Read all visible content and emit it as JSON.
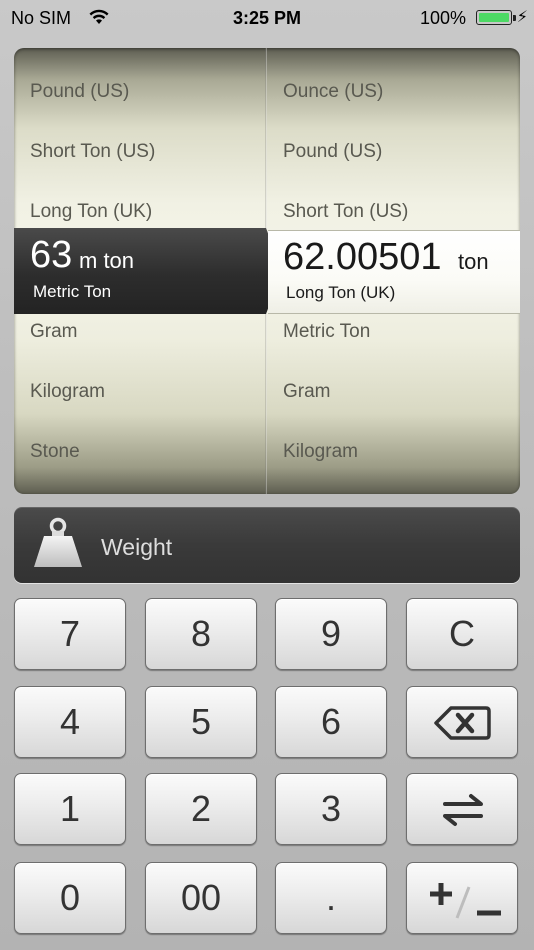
{
  "status_bar": {
    "carrier": "No SIM",
    "time": "3:25 PM",
    "battery": "100%"
  },
  "converter": {
    "from_list": [
      "Pound (US)",
      "Short Ton (US)",
      "Long Ton (UK)",
      "Gram",
      "Kilogram",
      "Stone"
    ],
    "to_list": [
      "Ounce (US)",
      "Pound (US)",
      "Short Ton (US)",
      "Metric Ton",
      "Gram",
      "Kilogram"
    ],
    "from_selected": {
      "value": "63",
      "unit": "m ton",
      "name": "Metric Ton"
    },
    "to_selected": {
      "value": "62.00501",
      "unit": "ton",
      "name": "Long Ton (UK)"
    }
  },
  "category": {
    "label": "Weight",
    "icon": "weight-icon"
  },
  "keypad": {
    "row1": [
      "7",
      "8",
      "9",
      "C"
    ],
    "row2": [
      "4",
      "5",
      "6"
    ],
    "row3": [
      "1",
      "2",
      "3"
    ],
    "row4": [
      "0",
      "00",
      "."
    ],
    "backspace_icon": "backspace-icon",
    "swap_icon": "swap-arrows-icon",
    "plus_minus_icon": "plus-minus-icon"
  },
  "colors": {
    "selection_dark": "#2d2d2d",
    "battery_green": "#4cd964"
  }
}
